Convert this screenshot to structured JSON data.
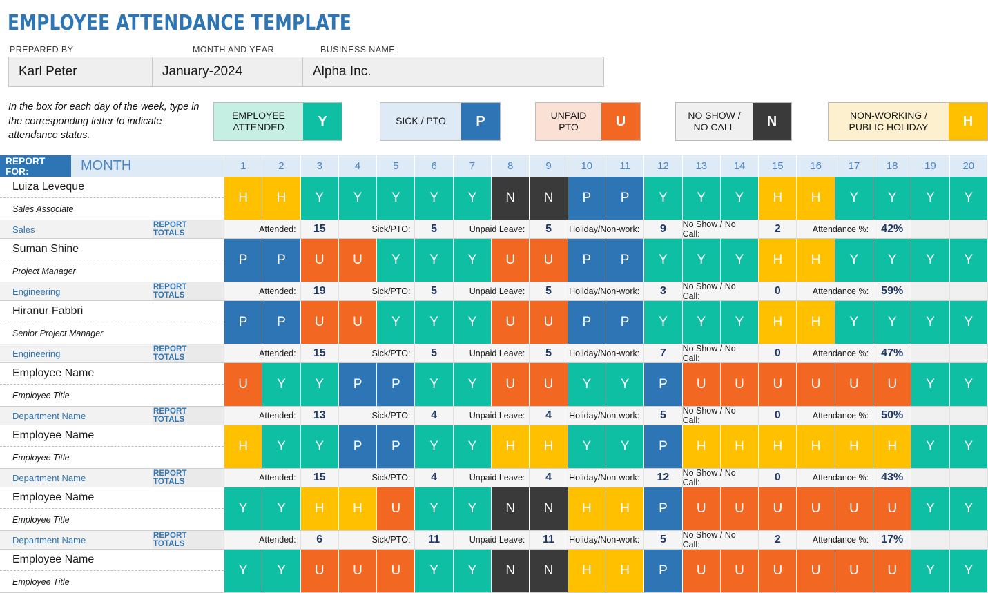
{
  "title": "EMPLOYEE ATTENDANCE TEMPLATE",
  "meta": {
    "labels": {
      "prepared_by": "PREPARED BY",
      "month_year": "MONTH AND YEAR",
      "business_name": "BUSINESS NAME"
    },
    "values": {
      "prepared_by": "Karl Peter",
      "month_year": "January-2024",
      "business_name": "Alpha Inc."
    }
  },
  "legend": {
    "note": "In the box for each day of the week,\ntype in the corresponding letter\nto indicate attendance status.",
    "items": [
      {
        "label": "EMPLOYEE\nATTENDED",
        "key": "Y",
        "label_bg": "#C6EFE3",
        "key_bg": "#0FBFA4"
      },
      {
        "label": "SICK / PTO",
        "key": "P",
        "label_bg": "#DEEAF6",
        "key_bg": "#2E75B6"
      },
      {
        "label": "UNPAID\nPTO",
        "key": "U",
        "label_bg": "#FBE0D5",
        "key_bg": "#F26722"
      },
      {
        "label": "NO SHOW /\nNO CALL",
        "key": "N",
        "label_bg": "#F0F0F0",
        "key_bg": "#3A3A3A"
      },
      {
        "label": "NON-WORKING /\nPUBLIC HOLIDAY",
        "key": "H",
        "label_bg": "#FDF0CE",
        "key_bg": "#FFC000"
      }
    ]
  },
  "status_colors": {
    "Y": "#0FBFA4",
    "P": "#2E75B6",
    "U": "#F26722",
    "N": "#3A3A3A",
    "H": "#FFC000"
  },
  "grid_header": {
    "report_for": "REPORT FOR:",
    "month": "MONTH",
    "days": [
      "1",
      "2",
      "3",
      "4",
      "5",
      "6",
      "7",
      "8",
      "9",
      "10",
      "11",
      "12",
      "13",
      "14",
      "15",
      "16",
      "17",
      "18",
      "19",
      "20"
    ]
  },
  "totals_labels": {
    "report_totals": "REPORT TOTALS",
    "attended": "Attended:",
    "sick": "Sick/PTO:",
    "unpaid": "Unpaid Leave:",
    "holiday": "Holiday/Non-work:",
    "noshow": "No Show / No Call:",
    "percent": "Attendance %:"
  },
  "employees": [
    {
      "name": "Luiza Leveque",
      "role": "Sales Associate",
      "department": "Sales",
      "days": [
        "H",
        "H",
        "Y",
        "Y",
        "Y",
        "Y",
        "Y",
        "N",
        "N",
        "P",
        "P",
        "Y",
        "Y",
        "Y",
        "H",
        "H",
        "Y",
        "Y",
        "Y",
        "Y"
      ],
      "totals": {
        "attended": "15",
        "sick": "5",
        "unpaid": "5",
        "holiday": "9",
        "noshow": "2",
        "percent": "42%"
      }
    },
    {
      "name": "Suman Shine",
      "role": "Project Manager",
      "department": "Engineering",
      "days": [
        "P",
        "P",
        "U",
        "U",
        "Y",
        "Y",
        "Y",
        "U",
        "U",
        "P",
        "P",
        "Y",
        "Y",
        "Y",
        "H",
        "H",
        "Y",
        "Y",
        "Y",
        "Y"
      ],
      "totals": {
        "attended": "19",
        "sick": "5",
        "unpaid": "5",
        "holiday": "3",
        "noshow": "0",
        "percent": "59%"
      }
    },
    {
      "name": "Hiranur Fabbri",
      "role": "Senior Project Manager",
      "department": "Engineering",
      "days": [
        "P",
        "P",
        "U",
        "U",
        "Y",
        "Y",
        "Y",
        "U",
        "U",
        "P",
        "P",
        "Y",
        "Y",
        "Y",
        "H",
        "H",
        "Y",
        "Y",
        "Y",
        "Y"
      ],
      "totals": {
        "attended": "15",
        "sick": "5",
        "unpaid": "5",
        "holiday": "7",
        "noshow": "0",
        "percent": "47%"
      }
    },
    {
      "name": "Employee Name",
      "role": "Employee Title",
      "department": "Department Name",
      "days": [
        "U",
        "Y",
        "Y",
        "P",
        "P",
        "Y",
        "Y",
        "U",
        "U",
        "Y",
        "Y",
        "P",
        "U",
        "U",
        "U",
        "U",
        "U",
        "U",
        "Y",
        "Y"
      ],
      "totals": {
        "attended": "13",
        "sick": "4",
        "unpaid": "4",
        "holiday": "5",
        "noshow": "0",
        "percent": "50%"
      }
    },
    {
      "name": "Employee Name",
      "role": "Employee Title",
      "department": "Department Name",
      "days": [
        "H",
        "Y",
        "Y",
        "P",
        "P",
        "Y",
        "Y",
        "H",
        "H",
        "Y",
        "Y",
        "P",
        "H",
        "H",
        "H",
        "H",
        "H",
        "H",
        "Y",
        "Y"
      ],
      "totals": {
        "attended": "15",
        "sick": "4",
        "unpaid": "4",
        "holiday": "12",
        "noshow": "0",
        "percent": "43%"
      }
    },
    {
      "name": "Employee Name",
      "role": "Employee Title",
      "department": "Department Name",
      "days": [
        "Y",
        "Y",
        "H",
        "H",
        "U",
        "Y",
        "Y",
        "N",
        "N",
        "H",
        "H",
        "P",
        "U",
        "U",
        "U",
        "U",
        "U",
        "U",
        "Y",
        "Y"
      ],
      "totals": {
        "attended": "6",
        "sick": "11",
        "unpaid": "11",
        "holiday": "5",
        "noshow": "2",
        "percent": "17%"
      }
    },
    {
      "name": "Employee Name",
      "role": "Employee Title",
      "department": "Department Name",
      "days": [
        "Y",
        "Y",
        "U",
        "U",
        "U",
        "Y",
        "Y",
        "N",
        "N",
        "H",
        "H",
        "P",
        "U",
        "U",
        "U",
        "U",
        "U",
        "U",
        "Y",
        "Y"
      ],
      "totals": {
        "attended": "",
        "sick": "",
        "unpaid": "",
        "holiday": "",
        "noshow": "",
        "percent": ""
      }
    }
  ]
}
